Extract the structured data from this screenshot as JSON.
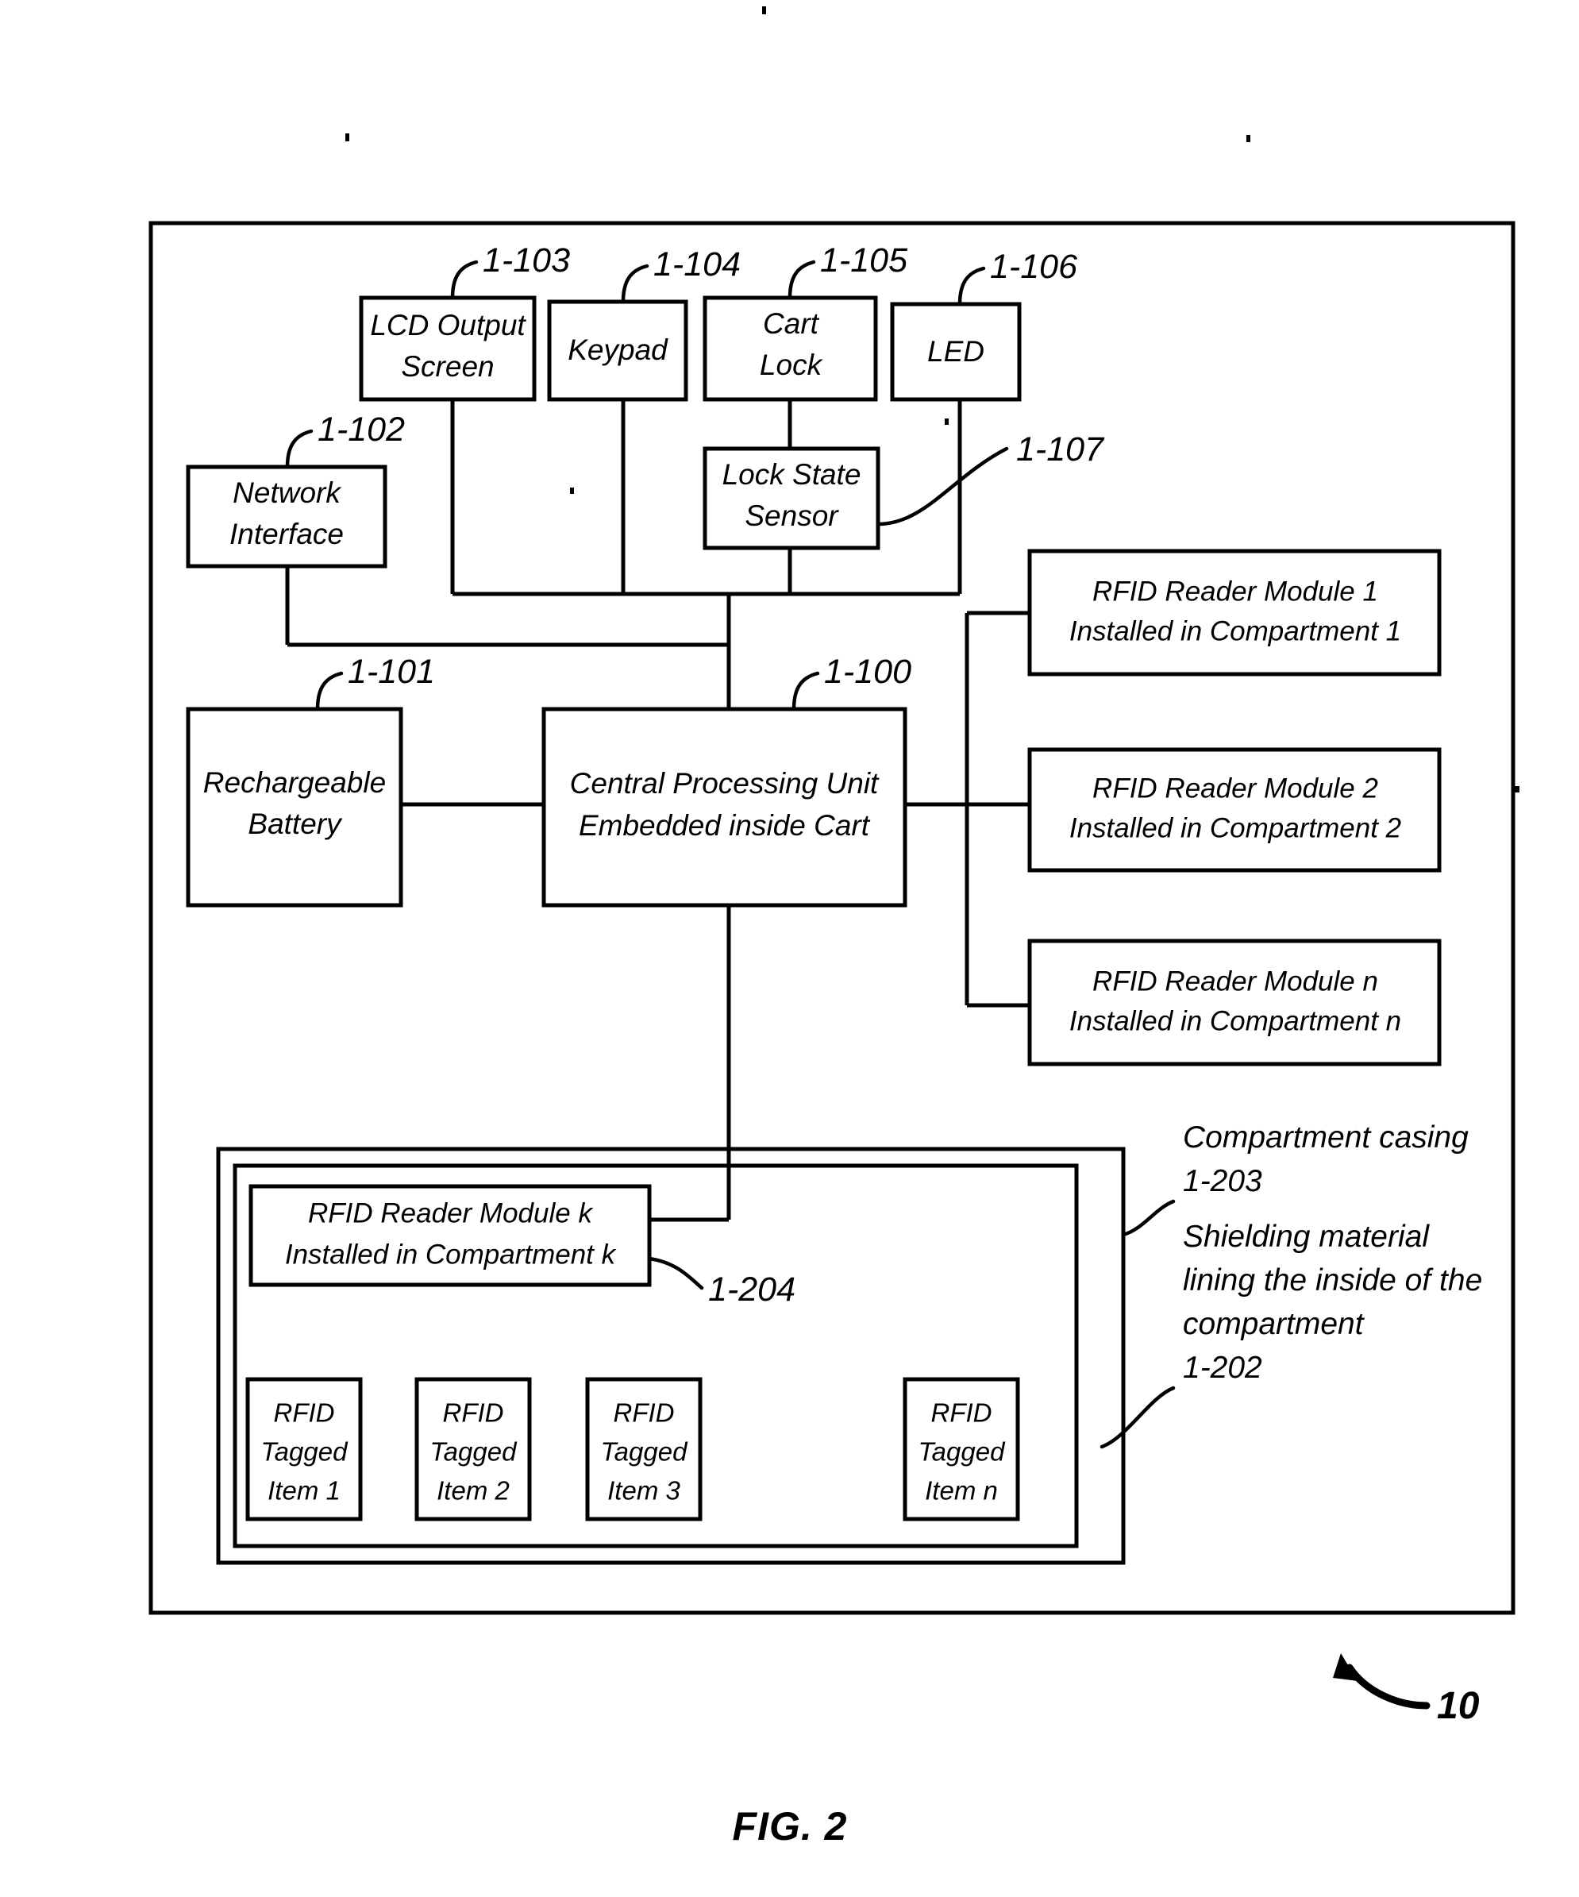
{
  "figure": {
    "caption": "FIG. 2",
    "system_ref": "10"
  },
  "top_row": {
    "lcd": {
      "line1": "LCD Output",
      "line2": "Screen",
      "ref": "1-103"
    },
    "keypad": {
      "line1": "Keypad",
      "ref": "1-104"
    },
    "cart_lock": {
      "line1": "Cart",
      "line2": "Lock",
      "ref": "1-105"
    },
    "led": {
      "line1": "LED",
      "ref": "1-106"
    },
    "lock_state_sensor": {
      "line1": "Lock State",
      "line2": "Sensor",
      "ref": "1-107"
    }
  },
  "left_column": {
    "network_interface": {
      "line1": "Network",
      "line2": "Interface",
      "ref": "1-102"
    },
    "battery": {
      "line1": "Rechargeable",
      "line2": "Battery",
      "ref": "1-101"
    }
  },
  "cpu": {
    "line1": "Central Processing Unit",
    "line2": "Embedded inside Cart",
    "ref": "1-100"
  },
  "reader_modules": [
    {
      "line1": "RFID Reader Module 1",
      "line2": "Installed in Compartment 1"
    },
    {
      "line1": "RFID Reader Module 2",
      "line2": "Installed in Compartment 2"
    },
    {
      "line1": "RFID Reader Module n",
      "line2": "Installed in Compartment n"
    }
  ],
  "compartment": {
    "reader_k": {
      "line1": "RFID Reader Module k",
      "line2": "Installed in Compartment k",
      "ref": "1-204"
    },
    "casing_note": {
      "line1": "Compartment casing",
      "ref": "1-203"
    },
    "shielding_note": {
      "line1": "Shielding material",
      "line2": "lining the inside of the",
      "line3": "compartment",
      "ref": "1-202"
    },
    "items": [
      {
        "line1": "RFID",
        "line2": "Tagged",
        "line3": "Item 1"
      },
      {
        "line1": "RFID",
        "line2": "Tagged",
        "line3": "Item 2"
      },
      {
        "line1": "RFID",
        "line2": "Tagged",
        "line3": "Item 3"
      },
      {
        "line1": "RFID",
        "line2": "Tagged",
        "line3": "Item n"
      }
    ]
  },
  "colors": {
    "ink": "#000000",
    "paper": "#ffffff"
  }
}
